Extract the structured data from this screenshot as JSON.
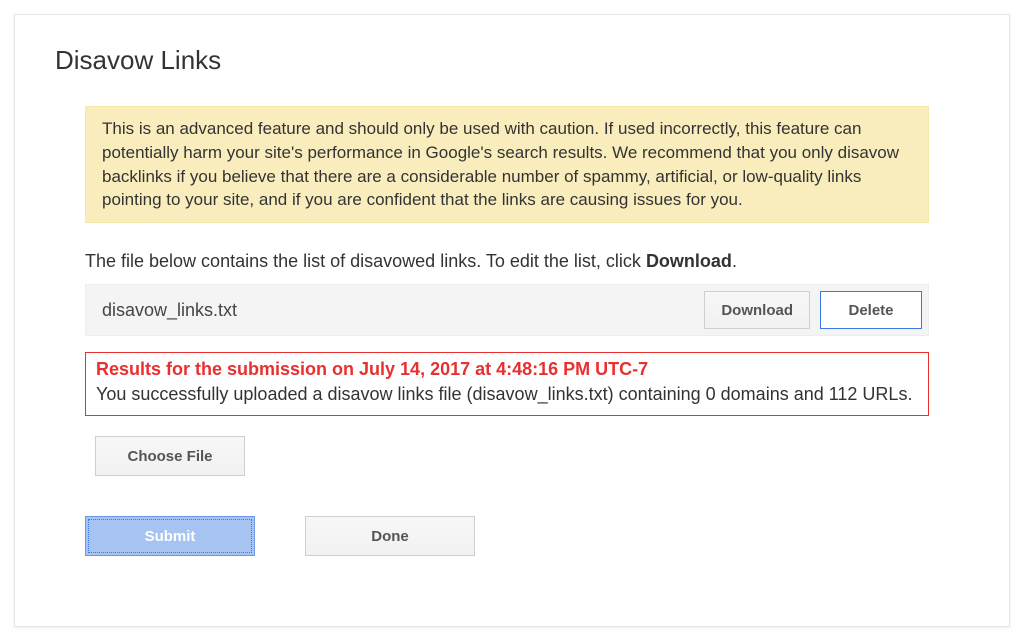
{
  "title": "Disavow Links",
  "warning": "This is an advanced feature and should only be used with caution. If used incorrectly, this feature can potentially harm your site's performance in Google's search results. We recommend that you only disavow backlinks if you believe that there are a considerable number of spammy, artificial, or low-quality links pointing to your site, and if you are confident that the links are causing issues for you.",
  "instruction_pre": "The file below contains the list of disavowed links. To edit the list, click ",
  "instruction_bold": "Download",
  "instruction_post": ".",
  "file": {
    "name": "disavow_links.txt",
    "download_label": "Download",
    "delete_label": "Delete"
  },
  "result": {
    "header": "Results for the submission on July 14, 2017 at 4:48:16 PM UTC-7",
    "body": "You successfully uploaded a disavow links file (disavow_links.txt) containing 0 domains and 112 URLs."
  },
  "buttons": {
    "choose_file": "Choose File",
    "submit": "Submit",
    "done": "Done"
  }
}
